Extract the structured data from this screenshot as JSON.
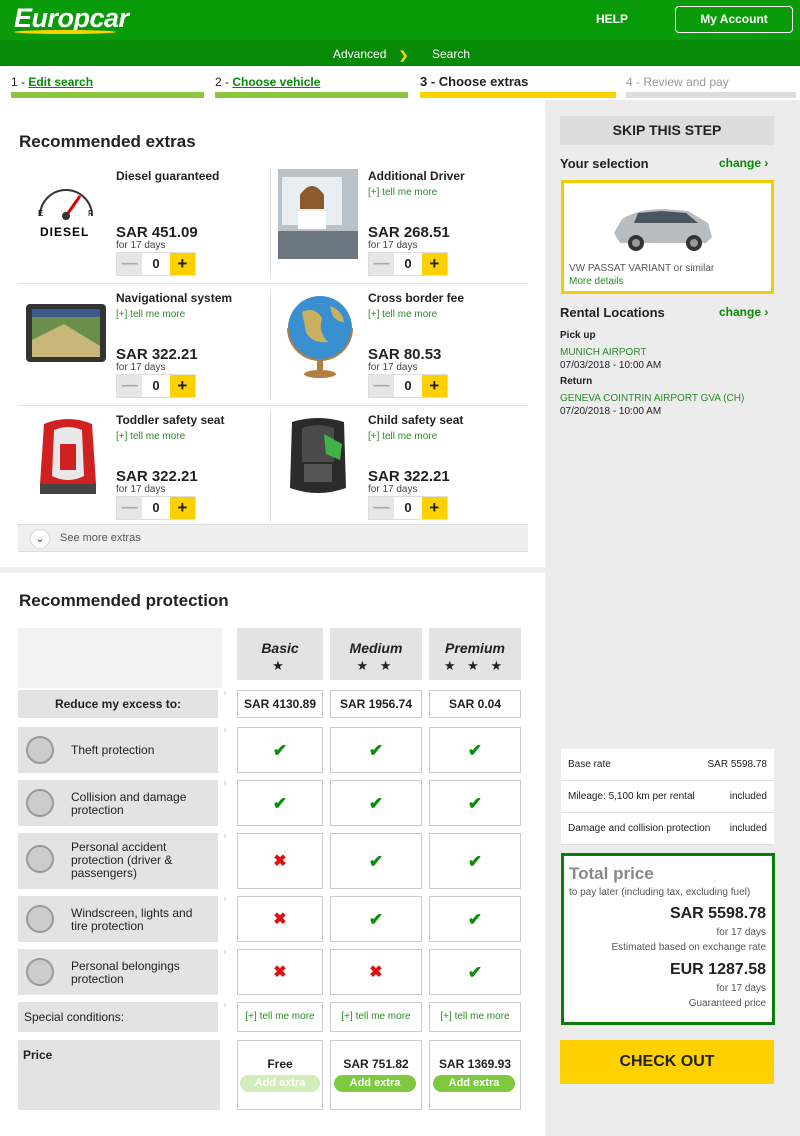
{
  "header": {
    "logo": "Europcar",
    "help": "HELP",
    "my_account": "My Account",
    "advanced": "Advanced",
    "search": "Search"
  },
  "steps": [
    {
      "num": "1 - ",
      "label": "Edit search"
    },
    {
      "num": "2 - ",
      "label": "Choose vehicle"
    },
    {
      "label": "3 - Choose extras"
    },
    {
      "label": "4 - Review and pay"
    }
  ],
  "extras": {
    "title": "Recommended extras",
    "items": [
      {
        "name": "Diesel guaranteed",
        "price": "SAR 451.09",
        "days": "for 17 days",
        "qty": "0",
        "tell": "",
        "icon_text": "DIESEL"
      },
      {
        "name": "Additional Driver",
        "price": "SAR 268.51",
        "days": "for 17 days",
        "qty": "0",
        "tell": "[+] tell me more"
      },
      {
        "name": "Navigational system",
        "price": "SAR 322.21",
        "days": "for 17 days",
        "qty": "0",
        "tell": "[+] tell me more"
      },
      {
        "name": "Cross border fee",
        "price": "SAR 80.53",
        "days": "for 17 days",
        "qty": "0",
        "tell": "[+] tell me more"
      },
      {
        "name": "Toddler safety seat",
        "price": "SAR 322.21",
        "days": "for 17 days",
        "qty": "0",
        "tell": "[+] tell me more"
      },
      {
        "name": "Child safety seat",
        "price": "SAR 322.21",
        "days": "for 17 days",
        "qty": "0",
        "tell": "[+] tell me more"
      }
    ],
    "see_more": "See more extras"
  },
  "protection": {
    "title": "Recommended protection",
    "columns": [
      {
        "name": "Basic",
        "stars": "★",
        "excess": "SAR 4130.89",
        "price": "Free",
        "add": "Add extra",
        "tell": "[+] tell me more"
      },
      {
        "name": "Medium",
        "stars": "★ ★",
        "excess": "SAR 1956.74",
        "price": "SAR 751.82",
        "add": "Add extra",
        "tell": "[+] tell me more"
      },
      {
        "name": "Premium",
        "stars": "★ ★ ★",
        "excess": "SAR 0.04",
        "price": "SAR 1369.93",
        "add": "Add extra",
        "tell": "[+] tell me more"
      }
    ],
    "reduce_label": "Reduce my excess to:",
    "rows": [
      {
        "label": "Theft protection",
        "values": [
          true,
          true,
          true
        ]
      },
      {
        "label": "Collision and damage protection",
        "values": [
          true,
          true,
          true
        ]
      },
      {
        "label": "Personal accident protection (driver & passengers)",
        "values": [
          false,
          true,
          true
        ]
      },
      {
        "label": "Windscreen, lights and tire protection",
        "values": [
          false,
          true,
          true
        ]
      },
      {
        "label": "Personal belongings protection",
        "values": [
          false,
          false,
          true
        ]
      }
    ],
    "special_label": "Special conditions:",
    "price_label": "Price",
    "check_glyph": "✔",
    "cross_glyph": "✖"
  },
  "sidebar": {
    "skip": "SKIP THIS STEP",
    "your_selection": "Your selection",
    "change": "change ›",
    "car_name": "VW PASSAT VARIANT or similar",
    "more_details": "More details",
    "rental_locations": "Rental Locations",
    "pickup_label": "Pick up",
    "pickup_place": "MUNICH AIRPORT",
    "pickup_time": "07/03/2018 - 10:00 AM",
    "return_label": "Return",
    "return_place": "GENEVA COINTRIN AIRPORT GVA (CH)",
    "return_time": "07/20/2018 - 10:00 AM",
    "rates": [
      {
        "label": "Base rate",
        "value": "SAR 5598.78"
      },
      {
        "label": "Mileage: 5,100 km per rental",
        "value": "included"
      },
      {
        "label": "Damage and collision protection",
        "value": "included"
      }
    ],
    "total_title": "Total price",
    "total_sub": "to pay later (including tax, excluding fuel)",
    "total_sar": "SAR 5598.78",
    "total_days": "for 17 days",
    "exchange_note": "Estimated based on exchange rate",
    "total_eur": "EUR 1287.58",
    "eur_days": "for 17 days",
    "guaranteed": "Guaranteed price",
    "checkout": "CHECK OUT"
  },
  "colors": {
    "brand_green": "#0a9b0a",
    "yellow": "#ffd100",
    "progress_green": "#8cc63f"
  }
}
